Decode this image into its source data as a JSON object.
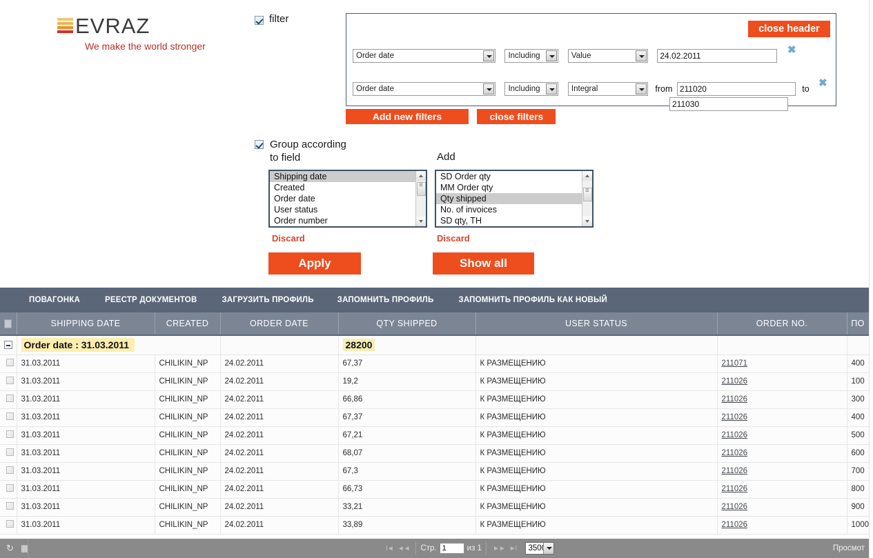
{
  "brand": {
    "name": "EVRAZ",
    "tagline": "We make the world stronger",
    "bar_colors": [
      "#f2c679",
      "#f0b64a",
      "#ee8f2e",
      "#d93025"
    ]
  },
  "filter_toggle": {
    "label": "filter",
    "checked": true
  },
  "filter_panel": {
    "close_header_label": "close header",
    "rows": [
      {
        "field": "Order date",
        "inclusion": "Including",
        "type": "Value",
        "value": "24.02.2011",
        "remove_icon": "✖"
      },
      {
        "field": "Order date",
        "inclusion": "Including",
        "type": "Integral",
        "from_label": "from",
        "from_value": "211020",
        "to_label": "to",
        "to_value": "211030",
        "remove_icon": "✖"
      }
    ],
    "add_new_filters_label": "Add new filters",
    "close_filters_label": "close filters"
  },
  "group": {
    "checked": true,
    "label_line1": "Group according",
    "label_line2": "to field",
    "add_label": "Add",
    "group_field_items": [
      "Shipping date",
      "Created",
      "Order date",
      "User status",
      "Order number"
    ],
    "group_field_selected": "Shipping date",
    "add_items": [
      "SD Order qty",
      "MM Order qty",
      "Qty shipped",
      "No. of invoices",
      "SD qty, TH"
    ],
    "add_selected": "Qty shipped",
    "discard_label_left": "Discard",
    "discard_label_right": "Discard",
    "apply_label": "Apply",
    "show_all_label": "Show all"
  },
  "navbar": {
    "items": [
      "ПОВАГОНКА",
      "РЕЕСТР ДОКУМЕНТОВ",
      "ЗАГРУЗИТЬ ПРОФИЛЬ",
      "ЗАПОМНИТЬ ПРОФИЛЬ",
      "ЗАПОМНИТЬ ПРОФИЛЬ КАК НОВЫЙ"
    ]
  },
  "table": {
    "columns": [
      "SHIPPING DATE",
      "CREATED",
      "ORDER DATE",
      "QTY SHIPPED",
      "USER STATUS",
      "ORDER  NO.",
      "ПО"
    ],
    "group_row": {
      "title": "Order date : 31.03.2011",
      "qty_shipped": "28200"
    },
    "rows": [
      {
        "shipping_date": "31.03.2011",
        "created": "CHILIKIN_NP",
        "order_date": "24.02.2011",
        "qty_shipped": "67,37",
        "user_status": "К РАЗМЕЩЕНИЮ",
        "order_no": "211071",
        "po": "400"
      },
      {
        "shipping_date": "31.03.2011",
        "created": "CHILIKIN_NP",
        "order_date": "24.02.2011",
        "qty_shipped": "19,2",
        "user_status": "К РАЗМЕЩЕНИЮ",
        "order_no": "211026",
        "po": "100"
      },
      {
        "shipping_date": "31.03.2011",
        "created": "CHILIKIN_NP",
        "order_date": "24.02.2011",
        "qty_shipped": "66,86",
        "user_status": "К РАЗМЕЩЕНИЮ",
        "order_no": "211026",
        "po": "300"
      },
      {
        "shipping_date": "31.03.2011",
        "created": "CHILIKIN_NP",
        "order_date": "24.02.2011",
        "qty_shipped": "67,37",
        "user_status": "К РАЗМЕЩЕНИЮ",
        "order_no": "211026",
        "po": "400"
      },
      {
        "shipping_date": "31.03.2011",
        "created": "CHILIKIN_NP",
        "order_date": "24.02.2011",
        "qty_shipped": "67,21",
        "user_status": "К РАЗМЕЩЕНИЮ",
        "order_no": "211026",
        "po": "500"
      },
      {
        "shipping_date": "31.03.2011",
        "created": "CHILIKIN_NP",
        "order_date": "24.02.2011",
        "qty_shipped": "68,07",
        "user_status": "К РАЗМЕЩЕНИЮ",
        "order_no": "211026",
        "po": "600"
      },
      {
        "shipping_date": "31.03.2011",
        "created": "CHILIKIN_NP",
        "order_date": "24.02.2011",
        "qty_shipped": "67,3",
        "user_status": "К РАЗМЕЩЕНИЮ",
        "order_no": "211026",
        "po": "700"
      },
      {
        "shipping_date": "31.03.2011",
        "created": "CHILIKIN_NP",
        "order_date": "24.02.2011",
        "qty_shipped": "66,73",
        "user_status": "К РАЗМЕЩЕНИЮ",
        "order_no": "211026",
        "po": "800"
      },
      {
        "shipping_date": "31.03.2011",
        "created": "CHILIKIN_NP",
        "order_date": "24.02.2011",
        "qty_shipped": "33,21",
        "user_status": "К РАЗМЕЩЕНИЮ",
        "order_no": "211026",
        "po": "900"
      },
      {
        "shipping_date": "31.03.2011",
        "created": "CHILIKIN_NP",
        "order_date": "24.02.2011",
        "qty_shipped": "33,89",
        "user_status": "К РАЗМЕЩЕНИЮ",
        "order_no": "211026",
        "po": "1000"
      }
    ]
  },
  "statusbar": {
    "refresh_icon": "↻",
    "grid_icon": "▦",
    "first_page_icon": "I◄",
    "prev_page_icon": "◄◄",
    "page_label": "Стр.",
    "page_value": "1",
    "of_label": "из 1",
    "next_page_icon": "►►",
    "last_page_icon": "►I",
    "page_size": "3500",
    "right_text": "Просмот"
  },
  "colors": {
    "accent_orange": "#ee4d1e",
    "navbar": "#5b6679",
    "table_header": "#7b8594",
    "statusbar": "#8a8a8a",
    "highlight_yellow": "#fdeeb0"
  }
}
